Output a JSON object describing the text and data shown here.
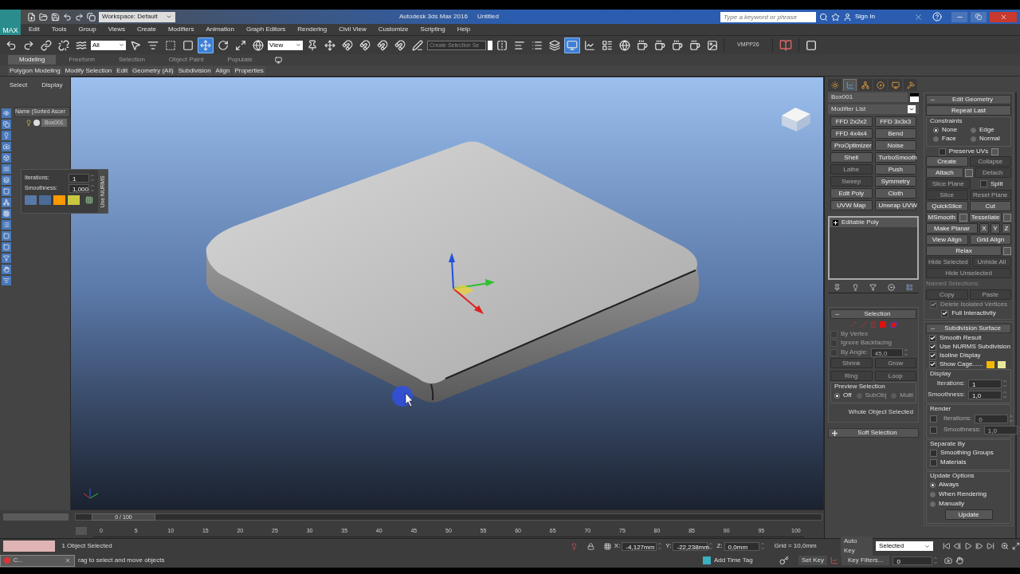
{
  "title_bar": {
    "logo": "MAX",
    "workspace": "Workspace: Default",
    "app_title": "Autodesk 3ds Max 2016",
    "document": "Untitled",
    "search": {
      "placeholder": "Type a keyword or phrase"
    },
    "sign_in": "Sign In"
  },
  "menu": [
    "Edit",
    "Tools",
    "Group",
    "Views",
    "Create",
    "Modifiers",
    "Animation",
    "Graph Editors",
    "Rendering",
    "Civil View",
    "Customize",
    "Scripting",
    "Help"
  ],
  "toolbar": {
    "selection_filter": "All",
    "reference_coordinate": "View",
    "named_selection": {
      "placeholder": "Create Selection Se"
    },
    "custom_label": "VMPP26"
  },
  "ribbon": {
    "tabs": [
      {
        "label": "Modeling",
        "selected": true
      },
      {
        "label": "Freeform",
        "selected": false
      },
      {
        "label": "Selection",
        "selected": false
      },
      {
        "label": "Object Paint",
        "selected": false
      },
      {
        "label": "Populate",
        "selected": false
      }
    ],
    "panels": [
      "Polygon Modeling",
      "Modify Selection",
      "Edit",
      "Geometry (All)",
      "Subdivision",
      "Align",
      "Properties"
    ]
  },
  "scene_explorer": {
    "tabs": [
      "Select",
      "Display"
    ],
    "column": "Name (Sorted Ascer",
    "objects": [
      {
        "name": "Box001",
        "selected": true
      }
    ]
  },
  "caddy": {
    "title": "Use NURMS",
    "fields": [
      {
        "label": "Iterations:",
        "value": "1"
      },
      {
        "label": "Smoothness:",
        "value": "1,000"
      }
    ],
    "cage_colors": [
      {
        "color": "#ff9900"
      },
      {
        "color": "#c8c840"
      }
    ]
  },
  "command_panel": {
    "tabs": [
      {
        "kind": "create",
        "selected": false
      },
      {
        "kind": "modify",
        "selected": true
      },
      {
        "kind": "hierarchy",
        "selected": false
      },
      {
        "kind": "motion",
        "selected": false
      },
      {
        "kind": "display",
        "selected": false
      },
      {
        "kind": "utilities",
        "selected": false
      }
    ],
    "object_name": "Box001",
    "modifier_list": "Modifier List",
    "modifier_buttons": [
      {
        "label": "FFD 2x2x2",
        "disabled": false
      },
      {
        "label": "FFD 3x3x3",
        "disabled": false
      },
      {
        "label": "FFD 4x4x4",
        "disabled": false
      },
      {
        "label": "Bend",
        "disabled": false
      },
      {
        "label": "ProOptimizer",
        "disabled": false
      },
      {
        "label": "Noise",
        "disabled": false
      },
      {
        "label": "Shell",
        "disabled": false
      },
      {
        "label": "TurboSmooth",
        "disabled": false
      },
      {
        "label": "Lathe",
        "disabled": true
      },
      {
        "label": "Push",
        "disabled": false
      },
      {
        "label": "Sweep",
        "disabled": true
      },
      {
        "label": "Symmetry",
        "disabled": false
      },
      {
        "label": "Edit Poly",
        "disabled": false
      },
      {
        "label": "Cloth",
        "disabled": false
      },
      {
        "label": "UVW Map",
        "disabled": false
      },
      {
        "label": "Unwrap UVW",
        "disabled": false
      }
    ],
    "stack": [
      {
        "label": "Editable Poly",
        "expanded": false
      }
    ],
    "selection": {
      "title": "Selection",
      "expanded": true,
      "options": [
        {
          "label": "By Vertex",
          "checked": false,
          "disabled": true
        },
        {
          "label": "Ignore Backfacing",
          "checked": false,
          "disabled": true
        }
      ],
      "by_angle": {
        "label": "By Angle:",
        "value": "45,0",
        "checked": false,
        "disabled": true
      },
      "buttons": [
        {
          "label": "Shrink",
          "disabled": true
        },
        {
          "label": "Grow",
          "disabled": true
        },
        {
          "label": "Ring",
          "disabled": true
        },
        {
          "label": "Loop",
          "disabled": true
        }
      ],
      "preview": {
        "label": "Preview Selection",
        "options": [
          {
            "label": "Off",
            "selected": true,
            "disabled": false
          },
          {
            "label": "SubObj",
            "selected": false,
            "disabled": true
          },
          {
            "label": "Multi",
            "selected": false,
            "disabled": true
          }
        ]
      },
      "status": "Whole Object Selected"
    },
    "soft_selection": {
      "title": "Soft Selection",
      "expanded": false
    },
    "edit_geometry": {
      "title": "Edit Geometry",
      "expanded": true,
      "repeat_last": "Repeat Last",
      "constraints": {
        "label": "Constraints",
        "options": [
          {
            "label": "None",
            "selected": true
          },
          {
            "label": "Edge",
            "selected": false
          },
          {
            "label": "Face",
            "selected": false
          },
          {
            "label": "Normal",
            "selected": false
          }
        ]
      },
      "preserve_uvs": {
        "label": "Preserve UVs",
        "checked": false
      },
      "rows": [
        [
          {
            "kind": "button",
            "label": "Create",
            "disabled": false
          },
          {
            "kind": "button",
            "label": "Collapse",
            "disabled": true
          }
        ],
        [
          {
            "kind": "button",
            "label": "Attach",
            "disabled": false
          },
          {
            "kind": "options"
          },
          {
            "kind": "button",
            "label": "Detach",
            "disabled": true
          }
        ],
        [
          {
            "kind": "button",
            "label": "Slice Plane",
            "disabled": true
          },
          {
            "kind": "checkbox",
            "label": "Split",
            "checked": false,
            "disabled": false
          }
        ],
        [
          {
            "kind": "button",
            "label": "Slice",
            "disabled": true
          },
          {
            "kind": "button",
            "label": "Reset Plane",
            "disabled": true
          }
        ],
        [
          {
            "kind": "button",
            "label": "QuickSlice",
            "disabled": false
          },
          {
            "kind": "button",
            "label": "Cut",
            "disabled": false
          }
        ],
        [
          {
            "kind": "button",
            "label": "MSmooth",
            "disabled": false
          },
          {
            "kind": "options"
          },
          {
            "kind": "button",
            "label": "Tessellate",
            "disabled": false
          },
          {
            "kind": "options"
          }
        ],
        [
          {
            "kind": "button",
            "label": "Make Planar",
            "disabled": false
          },
          {
            "kind": "button",
            "label": "X",
            "disabled": false
          },
          {
            "kind": "button",
            "label": "Y",
            "disabled": false
          },
          {
            "kind": "button",
            "label": "Z",
            "disabled": false
          }
        ],
        [
          {
            "kind": "button",
            "label": "View Align",
            "disabled": false
          },
          {
            "kind": "button",
            "label": "Grid Align",
            "disabled": false
          }
        ],
        [
          {
            "kind": "button",
            "label": "Relax",
            "disabled": false
          },
          {
            "kind": "options"
          }
        ],
        [
          {
            "kind": "button",
            "label": "Hide Selected",
            "disabled": true
          },
          {
            "kind": "button",
            "label": "Unhide All",
            "disabled": true
          }
        ],
        [
          {
            "kind": "button",
            "label": "Hide Unselected",
            "disabled": true
          }
        ],
        [
          {
            "kind": "label",
            "label": "Named Selections:",
            "disabled": true
          }
        ],
        [
          {
            "kind": "button",
            "label": "Copy",
            "disabled": true
          },
          {
            "kind": "button",
            "label": "Paste",
            "disabled": true
          }
        ],
        [
          {
            "kind": "checkbox",
            "label": "Delete Isolated Vertices",
            "checked": true,
            "disabled": true
          }
        ],
        [
          {
            "kind": "checkbox",
            "label": "Full Interactivity",
            "checked": true,
            "disabled": false
          }
        ]
      ]
    },
    "subdivision_surface": {
      "title": "Subdivision Surface",
      "expanded": true,
      "options": [
        {
          "label": "Smooth Result",
          "checked": true
        },
        {
          "label": "Use NURMS Subdivision",
          "checked": true
        },
        {
          "label": "Isoline Display",
          "checked": true
        },
        {
          "label": "Show Cage......",
          "checked": true
        }
      ],
      "cage_colors": [
        {
          "color": "#f5b800"
        },
        {
          "color": "#e8e89a"
        }
      ],
      "display": {
        "label": "Display",
        "fields": [
          {
            "label": "Iterations:",
            "value": "1"
          },
          {
            "label": "Smoothness:",
            "value": "1,0"
          }
        ]
      },
      "render": {
        "label": "Render",
        "fields": [
          {
            "label": "Iterations:",
            "value": "0",
            "checked": false
          },
          {
            "label": "Smoothness:",
            "value": "1,0",
            "checked": false
          }
        ]
      },
      "separate_by": {
        "label": "Separate By",
        "options": [
          {
            "label": "Smoothing Groups",
            "checked": false
          },
          {
            "label": "Materials",
            "checked": false
          }
        ]
      },
      "update_options": {
        "label": "Update Options",
        "options": [
          {
            "label": "Always",
            "selected": true
          },
          {
            "label": "When Rendering",
            "selected": false
          },
          {
            "label": "Manually",
            "selected": false
          }
        ],
        "button": "Update"
      }
    }
  },
  "timeline": {
    "position": "0 / 100",
    "level": 0,
    "ticks": [
      "0",
      "5",
      "10",
      "15",
      "20",
      "25",
      "30",
      "35",
      "40",
      "45",
      "50",
      "55",
      "60",
      "65",
      "70",
      "75",
      "80",
      "85",
      "90",
      "95",
      "100"
    ]
  },
  "status_bar": {
    "listener_window": "C...",
    "selection": "1 Object Selected",
    "prompt": "rag to select and move objects",
    "x": {
      "label": "X:",
      "value": "-4,127mm"
    },
    "y": {
      "label": "Y:",
      "value": "-22,238mm"
    },
    "z": {
      "label": "Z:",
      "value": "0,0mm"
    },
    "grid": "Grid = 10,0mm",
    "add_time_tag": "Add Time Tag",
    "auto_key": "Auto Key",
    "key_mode": "Selected",
    "set_key": "Set Key",
    "key_filters": "Key Filters...",
    "frame": "0"
  }
}
